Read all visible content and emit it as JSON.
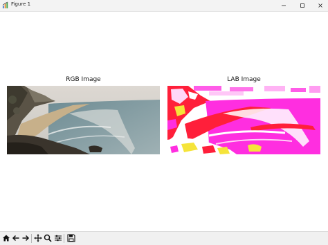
{
  "window": {
    "title": "Figure 1",
    "app_icon": "matplotlib-figure-icon",
    "controls": [
      "minimize-icon",
      "maximize-icon",
      "close-icon"
    ]
  },
  "figure": {
    "axes": [
      {
        "title": "RGB Image",
        "content": "coastal beach photograph"
      },
      {
        "title": "LAB Image",
        "content": "coastal beach photograph rendered in LAB colour values (magenta / red / yellow false colour)"
      }
    ]
  },
  "toolbar": {
    "tools": [
      "home-icon",
      "back-arrow-icon",
      "forward-arrow-icon",
      "pan-icon",
      "zoom-icon",
      "configure-subplots-icon",
      "save-icon"
    ]
  },
  "colors": {
    "lab_magenta": "#ff2ee0",
    "lab_red": "#ff1f3a",
    "lab_white": "#ffffff",
    "lab_yellow": "#f5e43a",
    "photo_sea": "#7d9aa3",
    "photo_sand": "#c9b28c"
  }
}
